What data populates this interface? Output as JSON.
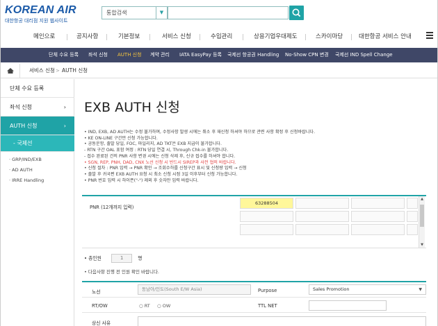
{
  "header": {
    "brand": "KOREAN AIR",
    "brand_sub": "대한항공 대리점 지원 웹사이트",
    "search_select": "통합검색",
    "search_placeholder": ""
  },
  "main_nav": [
    "메인으로",
    "공지사항",
    "기본정보",
    "서비스 신청",
    "수입관리",
    "상용기업우대제도",
    "스카이마당",
    "대한항공 서비스 안내"
  ],
  "sub_nav": [
    "단체 수요 등록",
    "좌석 신청",
    "AUTH 신청",
    "계약 관리",
    "IATA EasyPay 등록",
    "국제선 항공권 Handling",
    "No-Show CPN 변경",
    "국제선 IND Spell Change"
  ],
  "sub_nav_active": "AUTH 신청",
  "breadcrumb": [
    "서비스 신청",
    "AUTH 신청"
  ],
  "sidebar": {
    "items": [
      "단체 수요 등록",
      "좌석 신청",
      "AUTH 신청"
    ],
    "active_sub": "- 국제선",
    "small_items": [
      "· GRP/IND/EXB",
      "· AD AUTH",
      "· IRRE Handling"
    ]
  },
  "page_title": "EXB AUTH 신청",
  "notes": [
    {
      "text": "• IND, EXB, AD AUTH는 수정 불가하며, 수정사항 발생 시에는 취소 후 재신청 하셔야 하므로 관련 사항 확정 후 신청바랍니다.",
      "red": false
    },
    {
      "text": "• KE ON-LINE 구간만 신청 가능합니다.",
      "red": false
    },
    {
      "text": "• 공동운항, 출발 당일, FOC, 마일리지, AD TKT은 EXB 지급이 불가합니다.",
      "red": false
    },
    {
      "text": "  - RTN 구간 OAL 포함 여정 : RTN 당일 연결 시, Through Chk-in 불가합니다.",
      "red": false
    },
    {
      "text": "  - 접수 완료된 건의 PNR 사항 변경 시에는 신청 삭제 후, 신규 접수를 하셔야 합니다.",
      "red": false
    },
    {
      "text": "• SGN, REP, PNH, DAD, CNX 노선 신청 시 반드시 SIREP과 사전 협의 바랍니다.",
      "red": true
    },
    {
      "text": "• 신청 절차 : PNR 입력 → PNR 확인 → 조회수하를 신청구간 표시 및 신청량 입력 → 신청",
      "red": false
    },
    {
      "text": "• 출발 후 귀국편 EXB AUTH 요청 시 최소 신청 시점 3일 이후부터 신청 가능합니다.",
      "red": false
    },
    {
      "text": "• PNR 번호 입력 시 하이픈(\"-\") 제외 후 숫자만 입력 바랍니다.",
      "red": false
    }
  ],
  "pnr": {
    "label": "PNR (12개까지 입력)",
    "values": [
      "63288504",
      "",
      "",
      "",
      "",
      "",
      "",
      "",
      "",
      "",
      "",
      ""
    ]
  },
  "passenger": {
    "label": "• 총인원",
    "count": "1",
    "unit": "명",
    "note": "• 다음사항 진행 전 인원 확인 바랍니다."
  },
  "form": {
    "route_label": "노선",
    "route_value": "동남아/인도(South E/W Asia)",
    "purpose_label": "Purpose",
    "purpose_value": "Sales Promotion",
    "rtow_label": "RT/OW",
    "rt_label": "RT",
    "ow_label": "OW",
    "ttl_net_label": "TTL NET",
    "reason_label": "상신 사유"
  },
  "colors": {
    "teal": "#1fa3a6",
    "navy": "#3f4767",
    "highlight": "#fff79a",
    "active_subnav": "#f6c53e"
  }
}
